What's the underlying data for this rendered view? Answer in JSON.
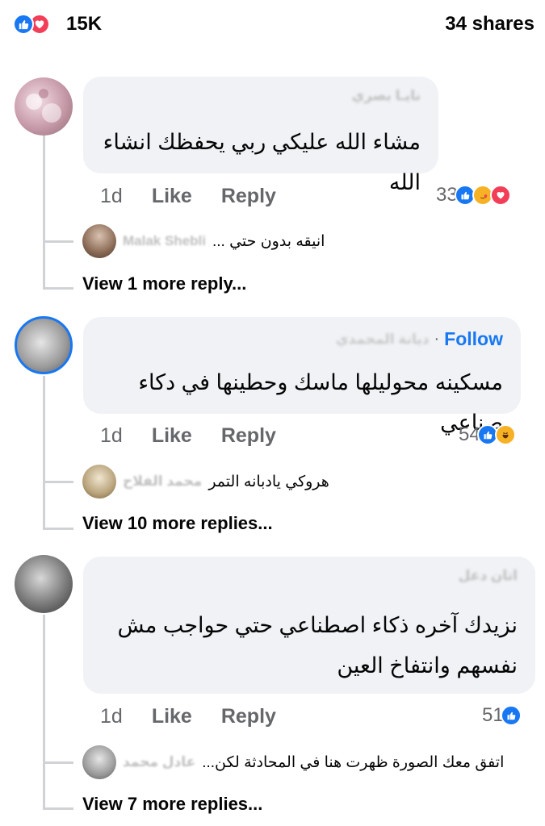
{
  "post_stats": {
    "reaction_count": "15K",
    "shares": "34 shares",
    "reaction_icons": [
      "like-icon",
      "love-icon"
    ]
  },
  "comments": [
    {
      "author": "نايـا بصري",
      "text_lines": [
        "مشاء الله عليكي ربي يحفظك انشاء الله"
      ],
      "age": "1d",
      "like_label": "Like",
      "reply_label": "Reply",
      "reaction_count": "33",
      "reaction_icons": [
        "like-icon",
        "care-icon",
        "love-icon"
      ],
      "reply_preview": {
        "author": "Malak Shebli",
        "text": "انيقه بدون حتي ..."
      },
      "view_more": "View 1 more reply..."
    },
    {
      "author": "ديانة المحمدي",
      "follow_label": "Follow",
      "text_lines": [
        "مسكينه محوليلها ماسك وحطينها في دكاء صناعي"
      ],
      "age": "1d",
      "like_label": "Like",
      "reply_label": "Reply",
      "reaction_count": "54",
      "reaction_icons": [
        "like-icon",
        "haha-icon"
      ],
      "reply_preview": {
        "author": "محمد الفلاح",
        "text": "هروكي يادبانه التمر"
      },
      "view_more": "View 10 more replies..."
    },
    {
      "author": "اتان دعل",
      "text_lines": [
        "نزيدك آخره ذكاء اصطناعي حتي حواجب مش",
        "نفسهم وانتفاخ العين"
      ],
      "age": "1d",
      "like_label": "Like",
      "reply_label": "Reply",
      "reaction_count": "51",
      "reaction_icons": [
        "like-icon"
      ],
      "reply_preview": {
        "author": "عادل محمد",
        "text": "اتفق معك الصورة ظهرت هنا في المحادثة لكن..."
      },
      "view_more": "View 7 more replies..."
    }
  ],
  "colors": {
    "like_blue": "#1877f2",
    "love_red": "#f33e58",
    "bubble_bg": "#f0f2f5",
    "meta_gray": "#65676b"
  }
}
